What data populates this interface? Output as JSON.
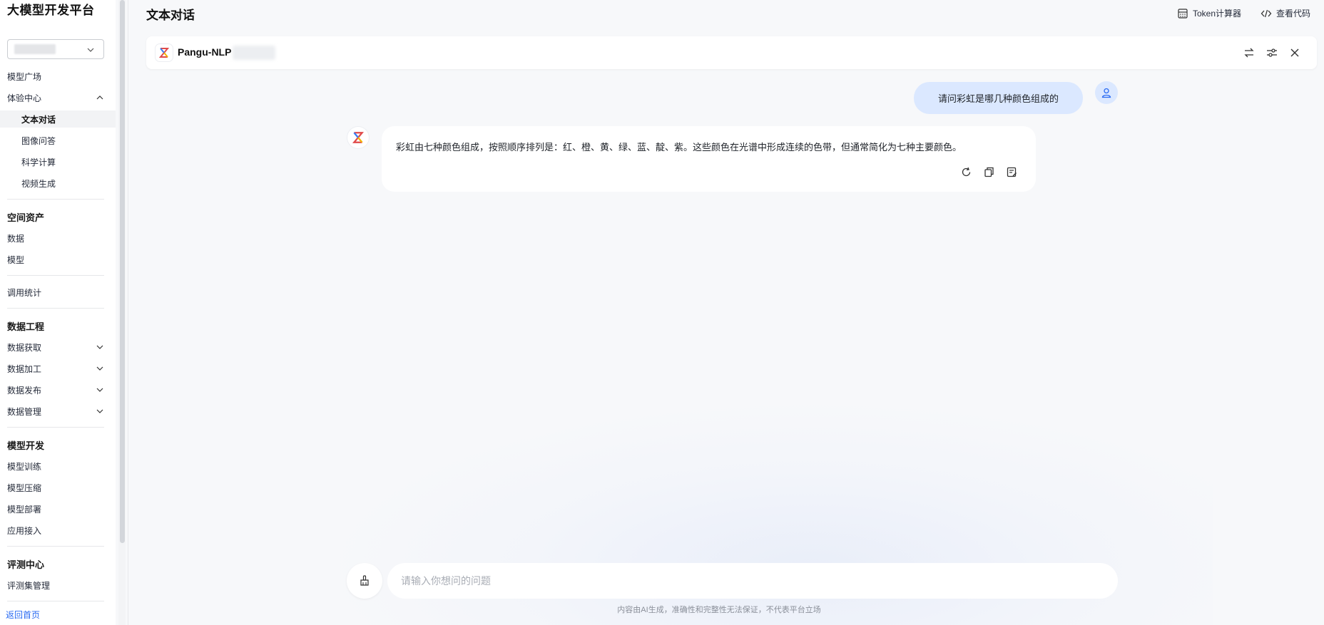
{
  "sidebar": {
    "brand": "大模型开发平台",
    "items": {
      "model_square": "模型广场",
      "experience_center": "体验中心",
      "text_chat": "文本对话",
      "image_qa": "图像问答",
      "science_calc": "科学计算",
      "video_gen": "视频生成",
      "space_assets": "空间资产",
      "data": "数据",
      "model": "模型",
      "call_stats": "调用统计",
      "data_engineering": "数据工程",
      "data_acquire": "数据获取",
      "data_process": "数据加工",
      "data_publish": "数据发布",
      "data_manage": "数据管理",
      "model_dev": "模型开发",
      "model_train": "模型训练",
      "model_compress": "模型压缩",
      "model_deploy": "模型部署",
      "app_access": "应用接入",
      "eval_center": "评测中心",
      "eval_set_manage": "评测集管理"
    },
    "back_home": "返回首页"
  },
  "header": {
    "title": "文本对话",
    "token_calc": "Token计算器",
    "view_code": "查看代码"
  },
  "model_bar": {
    "name": "Pangu-NLP"
  },
  "chat": {
    "user_message": "请问彩虹是哪几种颜色组成的",
    "bot_message": "彩虹由七种颜色组成，按照顺序排列是：红、橙、黄、绿、蓝、靛、紫。这些颜色在光谱中形成连续的色带，但通常简化为七种主要颜色。"
  },
  "input": {
    "placeholder": "请输入你想问的问题",
    "value": ""
  },
  "footer": {
    "disclaimer": "内容由AI生成，准确性和完整性无法保证，不代表平台立场"
  },
  "colors": {
    "accent": "#2a6bf2",
    "user_bubble": "#dbe8ff",
    "background": "#f7f8fa"
  }
}
